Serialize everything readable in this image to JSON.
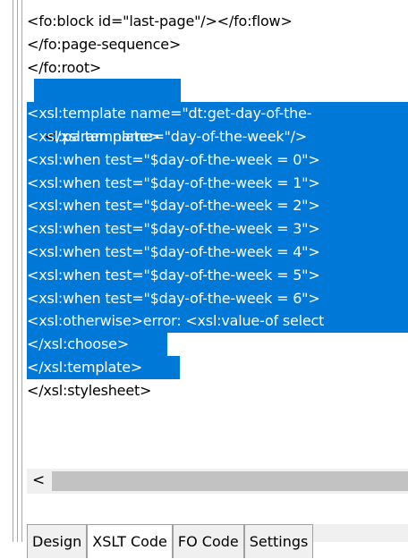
{
  "lines": [
    {
      "text": "<fo:block id=\"last-page\"/></fo:flow>"
    },
    {
      "text": "</fo:page-sequence>"
    },
    {
      "text": "</fo:root>"
    },
    {
      "a": "<",
      "b": "/xsl:template>"
    },
    {
      "text": "<xsl:template name=\"dt:get-day-of-the-"
    },
    {
      "text": "<xsl:param name=\"day-of-the-week\"/>"
    },
    {
      "text": "<xsl:when test=\"$day-of-the-week = 0\">"
    },
    {
      "text": "<xsl:when test=\"$day-of-the-week = 1\">"
    },
    {
      "text": "<xsl:when test=\"$day-of-the-week = 2\">"
    },
    {
      "text": "<xsl:when test=\"$day-of-the-week = 3\">"
    },
    {
      "text": "<xsl:when test=\"$day-of-the-week = 4\">"
    },
    {
      "text": "<xsl:when test=\"$day-of-the-week = 5\">"
    },
    {
      "text": "<xsl:when test=\"$day-of-the-week = 6\">"
    },
    {
      "a": "<xsl:otherwise>",
      "b": "error: <xsl:value-of select"
    },
    {
      "text": "</xsl:choose>"
    },
    {
      "text": "</xsl:template>"
    },
    {
      "text": "</xsl:stylesheet>"
    }
  ],
  "scroll": {
    "left_arrow": "<"
  },
  "tabs": [
    {
      "label": "Design"
    },
    {
      "label": "XSLT Code"
    },
    {
      "label": "FO Code"
    },
    {
      "label": "Settings"
    }
  ],
  "colors": {
    "selection": "#0078d7"
  }
}
